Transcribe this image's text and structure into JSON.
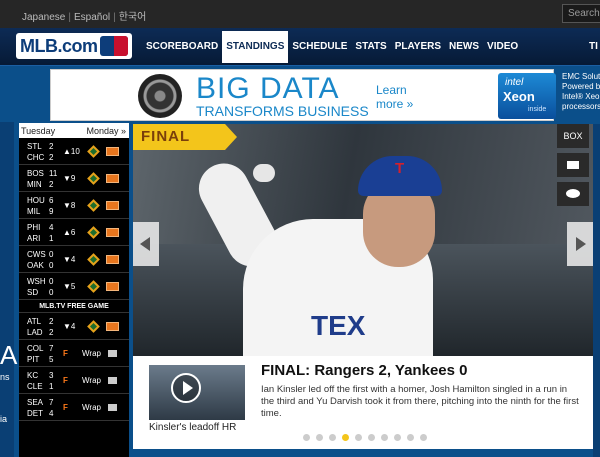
{
  "topbar": {
    "languages": [
      "Japanese",
      "Español",
      "한국어"
    ],
    "search_placeholder": "Search"
  },
  "header": {
    "logo_text": "MLB.com",
    "nav": [
      "SCOREBOARD",
      "STANDINGS",
      "SCHEDULE",
      "STATS",
      "PLAYERS",
      "NEWS",
      "VIDEO"
    ],
    "active_nav": "STANDINGS",
    "nav_tail": "TI"
  },
  "ad": {
    "headline": "BIG DATA",
    "subline": "TRANSFORMS BUSINESS",
    "cta": "Learn more »",
    "intel_brand": "intel",
    "intel_product": "Xeon",
    "intel_tag": "inside",
    "side_text": [
      "EMC Soluti",
      "Powered b",
      "Intel® Xeon",
      "processors"
    ]
  },
  "left_rail": {
    "letter": "A",
    "text1": "ns",
    "text2": "ia"
  },
  "scoreboard": {
    "day": "Tuesday",
    "next": "Monday »",
    "games": [
      {
        "away": "STL",
        "home": "CHC",
        "away_score": "2",
        "home_score": "2",
        "status": "▲10"
      },
      {
        "away": "BOS",
        "home": "MIN",
        "away_score": "11",
        "home_score": "2",
        "status": "▼9"
      },
      {
        "away": "HOU",
        "home": "MIL",
        "away_score": "6",
        "home_score": "9",
        "status": "▼8"
      },
      {
        "away": "PHI",
        "home": "ARI",
        "away_score": "4",
        "home_score": "1",
        "status": "▲6"
      },
      {
        "away": "CWS",
        "home": "OAK",
        "away_score": "0",
        "home_score": "0",
        "status": "▼4"
      },
      {
        "away": "WSH",
        "home": "SD",
        "away_score": "0",
        "home_score": "0",
        "status": "▼5"
      }
    ],
    "free_game_label": "MLB.TV FREE GAME",
    "free_game": {
      "away": "ATL",
      "home": "LAD",
      "away_score": "2",
      "home_score": "2",
      "status": "▼4"
    },
    "final_games": [
      {
        "away": "COL",
        "home": "PIT",
        "away_score": "7",
        "home_score": "5",
        "status": "F",
        "wrap": "Wrap"
      },
      {
        "away": "KC",
        "home": "CLE",
        "away_score": "3",
        "home_score": "1",
        "status": "F",
        "wrap": "Wrap"
      },
      {
        "away": "SEA",
        "home": "DET",
        "away_score": "7",
        "home_score": "4",
        "status": "F",
        "wrap": "Wrap"
      }
    ]
  },
  "feature": {
    "tag": "FINAL",
    "tools": [
      "BOX"
    ],
    "cap_logo": "T",
    "jersey_text": "TEX",
    "headline": "FINAL: Rangers 2, Yankees 0",
    "summary": "Ian Kinsler led off the first with a homer, Josh Hamilton singled in a run in the third and Yu Darvish took it from there, pitching into the ninth for the first time.",
    "video_caption": "Kinsler's leadoff HR",
    "slide_count": 10,
    "active_slide": 3
  },
  "colors": {
    "brand_blue": "#0b4f8a",
    "final_yellow": "#f3c51b",
    "status_orange": "#ff7a1a"
  }
}
